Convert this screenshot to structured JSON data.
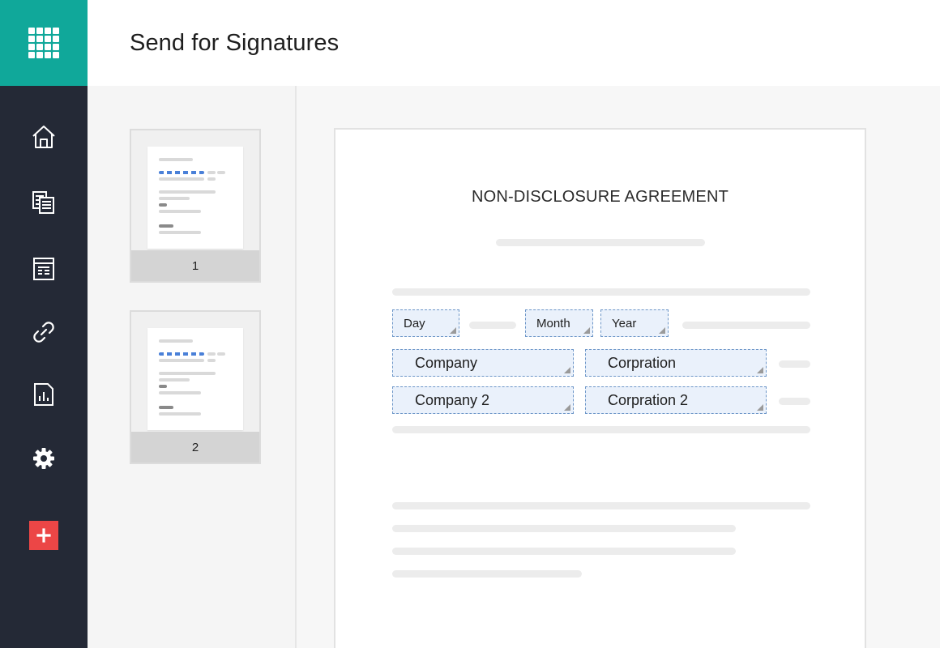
{
  "header": {
    "title": "Send for Signatures"
  },
  "sidebar": {
    "colors": {
      "background": "#242936",
      "apps": "#10a89a",
      "add": "#ec4646"
    },
    "apps_icon": "apps-grid-icon",
    "items": [
      {
        "name": "home",
        "icon": "home-icon"
      },
      {
        "name": "documents",
        "icon": "documents-icon"
      },
      {
        "name": "templates",
        "icon": "template-icon"
      },
      {
        "name": "links",
        "icon": "link-icon"
      },
      {
        "name": "reports",
        "icon": "report-icon"
      },
      {
        "name": "settings",
        "icon": "gear-icon"
      }
    ],
    "add_icon": "plus-icon"
  },
  "thumbnails": [
    {
      "label": "1"
    },
    {
      "label": "2"
    }
  ],
  "document": {
    "title": "NON-DISCLOSURE AGREEMENT",
    "fields": {
      "day": "Day",
      "month": "Month",
      "year": "Year",
      "company": "Company",
      "corporation": "Corpration",
      "company2": "Company 2",
      "corporation2": "Corpration 2"
    },
    "field_color": "#eaf1fb",
    "field_border_color": "#6d96c8"
  }
}
